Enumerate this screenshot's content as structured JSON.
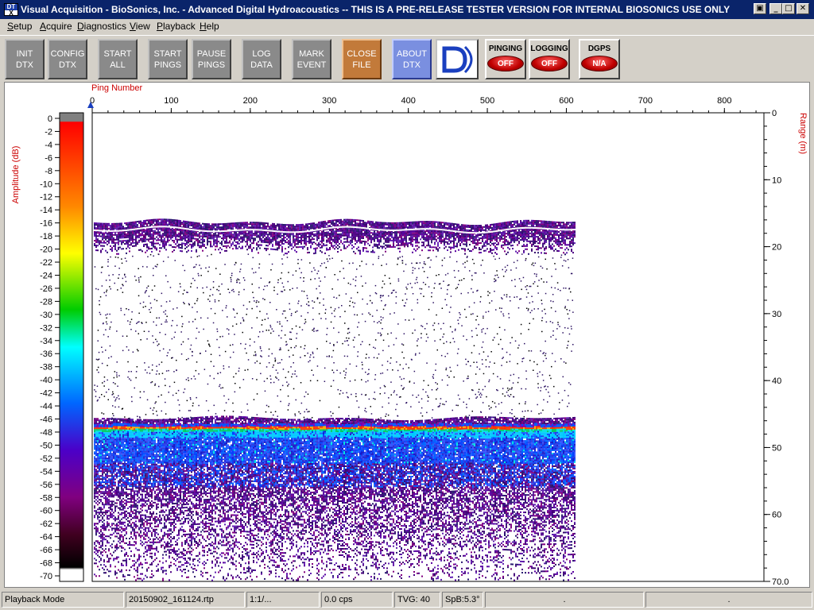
{
  "window": {
    "title": "Visual Acquisition  -  BioSonics, Inc.  -  Advanced Digital Hydroacoustics  -- THIS IS A PRE-RELEASE TESTER VERSION FOR INTERNAL BIOSONICS USE ONLY",
    "icon_text_top": "DT",
    "icon_text_bottom": "X",
    "restore_glyph": "▣",
    "minimize_glyph": "_",
    "maximize_glyph": "□",
    "close_glyph": "✕"
  },
  "menu": [
    "Setup",
    "Acquire",
    "Diagnostics",
    "View",
    "Playback",
    "Help"
  ],
  "toolbar": {
    "buttons": [
      {
        "line1": "INIT",
        "line2": "DTX"
      },
      {
        "line1": "CONFIG",
        "line2": "DTX"
      },
      {
        "line1": "START",
        "line2": "ALL"
      },
      {
        "line1": "START",
        "line2": "PINGS"
      },
      {
        "line1": "PAUSE",
        "line2": "PINGS"
      },
      {
        "line1": "LOG",
        "line2": "DATA"
      },
      {
        "line1": "MARK",
        "line2": "EVENT"
      },
      {
        "line1": "CLOSE",
        "line2": "FILE"
      },
      {
        "line1": "ABOUT",
        "line2": "DTX"
      }
    ],
    "indicators": [
      {
        "label": "PINGING",
        "state": "OFF"
      },
      {
        "label": "LOGGING",
        "state": "OFF"
      },
      {
        "label": "DGPS",
        "state": "N/A"
      }
    ]
  },
  "plot": {
    "x_axis_label": "Ping Number",
    "x_ticks": [
      "0",
      "100",
      "200",
      "300",
      "400",
      "500",
      "600",
      "700",
      "800"
    ],
    "x_max": 850,
    "y_axis_label": "Range (m)",
    "y_ticks": [
      "0",
      "10",
      "20",
      "30",
      "40",
      "50",
      "60",
      "70.0"
    ],
    "y_max": 70,
    "colorbar_label": "Amplitude (dB)",
    "colorbar_ticks": [
      "0",
      "-2",
      "-4",
      "-6",
      "-8",
      "-10",
      "-12",
      "-14",
      "-16",
      "-18",
      "-20",
      "-22",
      "-24",
      "-26",
      "-28",
      "-30",
      "-32",
      "-34",
      "-36",
      "-38",
      "-40",
      "-42",
      "-44",
      "-46",
      "-48",
      "-50",
      "-52",
      "-54",
      "-56",
      "-58",
      "-60",
      "-62",
      "-64",
      "-66",
      "-68",
      "-70"
    ],
    "data_ping_end": 610,
    "surface_band_range_m": 17,
    "bottom_range_m": 47.5
  },
  "status": {
    "mode": "Playback Mode",
    "file": "20150902_161124.rtp",
    "ratio": "1:1/...",
    "cps": "0.0 cps",
    "tvg": "TVG: 40",
    "spb": "SpB:5.3°",
    "field7": ".",
    "field8": "."
  }
}
